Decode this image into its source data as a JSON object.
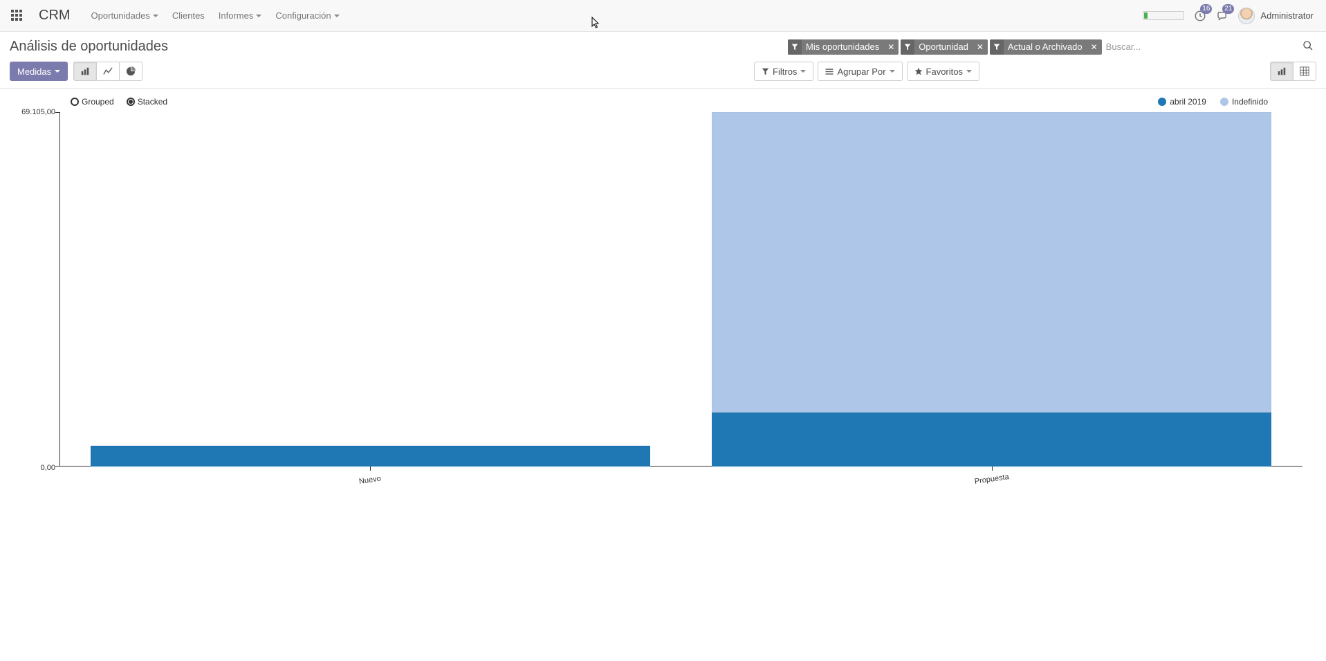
{
  "navbar": {
    "brand": "CRM",
    "menus": [
      {
        "label": "Oportunidades",
        "dropdown": true
      },
      {
        "label": "Clientes",
        "dropdown": false
      },
      {
        "label": "Informes",
        "dropdown": true
      },
      {
        "label": "Configuración",
        "dropdown": true
      }
    ],
    "tray": {
      "activities_badge": "16",
      "messages_badge": "21"
    },
    "user": "Administrator"
  },
  "page": {
    "title": "Análisis de oportunidades"
  },
  "search": {
    "placeholder": "Buscar...",
    "facets": [
      {
        "label": "Mis oportunidades"
      },
      {
        "label": "Oportunidad"
      },
      {
        "label": "Actual o Archivado"
      }
    ]
  },
  "toolbar": {
    "measures_label": "Medidas",
    "filters_label": "Filtros",
    "group_by_label": "Agrupar Por",
    "favorites_label": "Favoritos"
  },
  "chart": {
    "stack_toggle": {
      "grouped_label": "Grouped",
      "stacked_label": "Stacked",
      "selected": "stacked"
    },
    "legend": [
      {
        "name": "abril 2019",
        "color": "#1f77b4"
      },
      {
        "name": "Indefinido",
        "color": "#aec7e8"
      }
    ],
    "y_max_label": "69.105,00",
    "y_min_label": "0,00"
  },
  "chart_data": {
    "type": "bar",
    "stacked": true,
    "categories": [
      "Nuevo",
      "Propuesta"
    ],
    "series": [
      {
        "name": "abril 2019",
        "color": "#1f77b4",
        "values": [
          4100,
          10500
        ]
      },
      {
        "name": "Indefinido",
        "color": "#aec7e8",
        "values": [
          0,
          58605
        ]
      }
    ],
    "ylim": [
      0,
      69105
    ],
    "ylabel": "",
    "xlabel": ""
  }
}
